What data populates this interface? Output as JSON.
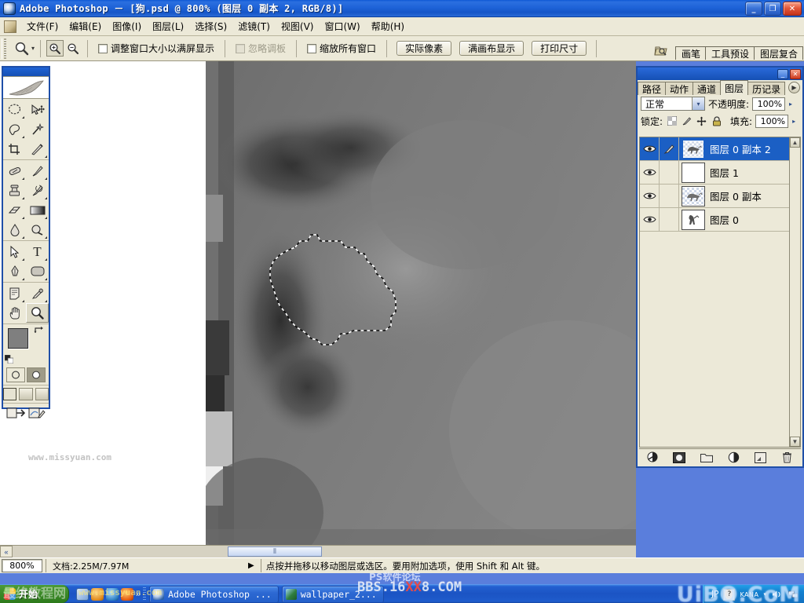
{
  "window": {
    "title": "Adobe Photoshop － [狗.psd @ 800% (图层 0 副本 2, RGB/8)]",
    "app_icon": "photoshop-icon",
    "minimize_label": "_",
    "maximize_label": "❐",
    "close_label": "✕"
  },
  "menubar": {
    "doc_icon": "document-icon",
    "items": [
      {
        "label": "文件(F)"
      },
      {
        "label": "编辑(E)"
      },
      {
        "label": "图像(I)"
      },
      {
        "label": "图层(L)"
      },
      {
        "label": "选择(S)"
      },
      {
        "label": "滤镜(T)"
      },
      {
        "label": "视图(V)"
      },
      {
        "label": "窗口(W)"
      },
      {
        "label": "帮助(H)"
      }
    ]
  },
  "options_bar": {
    "tool_icon": "zoom-tool-icon",
    "tool_dropdown_arrow": "▾",
    "zoom_in_icon": "zoom-in-icon",
    "zoom_out_icon": "zoom-out-icon",
    "checkboxes": [
      {
        "label": "调整窗口大小以满屏显示",
        "checked": false,
        "disabled": false
      },
      {
        "label": "忽略调板",
        "checked": false,
        "disabled": true
      },
      {
        "label": "缩放所有窗口",
        "checked": false,
        "disabled": false
      }
    ],
    "buttons": [
      {
        "label": "实际像素"
      },
      {
        "label": "满画布显示"
      },
      {
        "label": "打印尺寸"
      }
    ],
    "well_icon": "palette-well-icon",
    "well_tabs": [
      {
        "label": "画笔"
      },
      {
        "label": "工具预设"
      },
      {
        "label": "图层复合"
      }
    ]
  },
  "toolbox": {
    "logo_icon": "feather-logo-icon",
    "tools": [
      [
        {
          "name": "marquee-tool",
          "glyph": "◯",
          "has_submenu": true
        },
        {
          "name": "move-tool",
          "glyph": "✥",
          "has_submenu": false
        }
      ],
      [
        {
          "name": "lasso-tool",
          "glyph": "✎",
          "has_submenu": true
        },
        {
          "name": "magic-wand-tool",
          "glyph": "✷",
          "has_submenu": false
        }
      ],
      [
        {
          "name": "crop-tool",
          "glyph": "⌗",
          "has_submenu": false
        },
        {
          "name": "slice-tool",
          "glyph": "✂",
          "has_submenu": true
        }
      ],
      [
        {
          "name": "healing-brush-tool",
          "glyph": "⬭",
          "has_submenu": true
        },
        {
          "name": "brush-tool",
          "glyph": "✐",
          "has_submenu": true
        }
      ],
      [
        {
          "name": "clone-stamp-tool",
          "glyph": "⎙",
          "has_submenu": true
        },
        {
          "name": "history-brush-tool",
          "glyph": "✑",
          "has_submenu": true
        }
      ],
      [
        {
          "name": "eraser-tool",
          "glyph": "▱",
          "has_submenu": true
        },
        {
          "name": "gradient-tool",
          "glyph": "▤",
          "has_submenu": true
        }
      ],
      [
        {
          "name": "blur-tool",
          "glyph": "💧",
          "has_submenu": true
        },
        {
          "name": "dodge-tool",
          "glyph": "◑",
          "has_submenu": true
        }
      ],
      [
        {
          "name": "path-selection-tool",
          "glyph": "➤",
          "has_submenu": true
        },
        {
          "name": "type-tool",
          "glyph": "T",
          "has_submenu": true
        }
      ],
      [
        {
          "name": "pen-tool",
          "glyph": "✒",
          "has_submenu": true
        },
        {
          "name": "shape-tool",
          "glyph": "▭",
          "has_submenu": true
        }
      ],
      [
        {
          "name": "notes-tool",
          "glyph": "🗎",
          "has_submenu": true
        },
        {
          "name": "eyedropper-tool",
          "glyph": "⚲",
          "has_submenu": true
        }
      ],
      [
        {
          "name": "hand-tool",
          "glyph": "✋",
          "has_submenu": false
        },
        {
          "name": "zoom-tool",
          "glyph": "🔍",
          "has_submenu": false,
          "selected": true
        }
      ]
    ],
    "colors": {
      "foreground": "#7f7f7f",
      "background": "#ffffff",
      "swap_icon": "swap-colors-icon",
      "default_icon": "default-colors-icon"
    },
    "mask_modes": [
      {
        "name": "standard-mask-mode",
        "active": true
      },
      {
        "name": "quick-mask-mode",
        "active": false
      }
    ],
    "screen_modes": [
      {
        "name": "standard-screen-mode",
        "active": true
      },
      {
        "name": "full-screen-with-menubar-mode",
        "active": false
      },
      {
        "name": "full-screen-mode",
        "active": false
      }
    ],
    "jump_buttons": [
      {
        "name": "jump-to-imageready-icon"
      },
      {
        "name": "jump-to-editor-icon"
      }
    ]
  },
  "document": {
    "zoom_level": "800%",
    "doc_info": "文档:2.25M/7.97M",
    "status_hint": "点按并拖移以移动图层或选区。要用附加选项，使用 Shift 和 Alt 键。",
    "status_arrow": "▶",
    "scroll_left_arrow": "«",
    "canvas_watermark": "www.missyuan.com",
    "selection_label": "marching-ants-selection"
  },
  "layers_panel": {
    "minimize_label": "_",
    "close_label": "✕",
    "menu_icon": "palette-menu-icon",
    "tabs": [
      {
        "label": "路径",
        "active": false
      },
      {
        "label": "动作",
        "active": false
      },
      {
        "label": "通道",
        "active": false
      },
      {
        "label": "图层",
        "active": true
      },
      {
        "label": "历记录",
        "active": false
      }
    ],
    "blend_mode": "正常",
    "blend_arrow": "▾",
    "opacity_label": "不透明度:",
    "opacity_value": "100%",
    "lock_label": "锁定:",
    "lock_icons": [
      {
        "name": "lock-transparent-pixels-icon",
        "glyph": "▨"
      },
      {
        "name": "lock-image-pixels-icon",
        "glyph": "✎"
      },
      {
        "name": "lock-position-icon",
        "glyph": "✛"
      },
      {
        "name": "lock-all-icon",
        "glyph": "🔒"
      }
    ],
    "fill_label": "填充:",
    "fill_value": "100%",
    "spin_arrow": "▸",
    "layers": [
      {
        "name": "图层 0 副本 2",
        "visible": true,
        "selected": true,
        "thumb": "dog-transparent",
        "has_brush_icon": true
      },
      {
        "name": "图层 1",
        "visible": true,
        "selected": false,
        "thumb": "white-fill",
        "has_brush_icon": false
      },
      {
        "name": "图层 0 副本",
        "visible": true,
        "selected": false,
        "thumb": "dog-transparent",
        "has_brush_icon": false
      },
      {
        "name": "图层 0",
        "visible": true,
        "selected": false,
        "thumb": "dog-white",
        "has_brush_icon": false
      }
    ],
    "eye_icon": "eye-visibility-icon",
    "brush_icon": "active-layer-brush-icon",
    "scroll_up_arrow": "▲",
    "scroll_down_arrow": "▼",
    "bottom_buttons": [
      {
        "name": "layer-style-icon",
        "glyph": "◍"
      },
      {
        "name": "layer-mask-icon",
        "glyph": "◙"
      },
      {
        "name": "new-group-icon",
        "glyph": "🗀"
      },
      {
        "name": "adjustment-layer-icon",
        "glyph": "◐"
      },
      {
        "name": "new-layer-icon",
        "glyph": "⬓"
      },
      {
        "name": "delete-layer-icon",
        "glyph": "🗑"
      }
    ]
  },
  "taskbar": {
    "start_label": "开始",
    "start_icon": "windows-flag-icon",
    "quicklaunch": [
      {
        "name": "show-desktop-icon"
      },
      {
        "name": "ie-browser-icon"
      },
      {
        "name": "media-player-icon"
      },
      {
        "name": "firefox-icon"
      }
    ],
    "quicklaunch_more": "»",
    "buttons": [
      {
        "label": "Adobe Photoshop ...",
        "icon": "photoshop-icon",
        "active": true
      },
      {
        "label": "wallpaper_2...",
        "icon": "image-viewer-icon",
        "active": false
      }
    ],
    "tray": {
      "ime_label": "JP",
      "ime_mode_icon": "ime-mode-icon",
      "kana_label": "KANA",
      "kana_arrow": "▾",
      "icons": [
        {
          "name": "volume-icon"
        },
        {
          "name": "network-icon"
        }
      ]
    }
  },
  "watermarks": {
    "main": "UiBQ.CoM",
    "bbs_prefix": "BBS.16",
    "bbs_x": "XX",
    "bbs_suffix": "8.COM",
    "cn_text": "PS软件论坛",
    "left_text": "最终教程网",
    "url_text": "www.missyuan.com"
  }
}
